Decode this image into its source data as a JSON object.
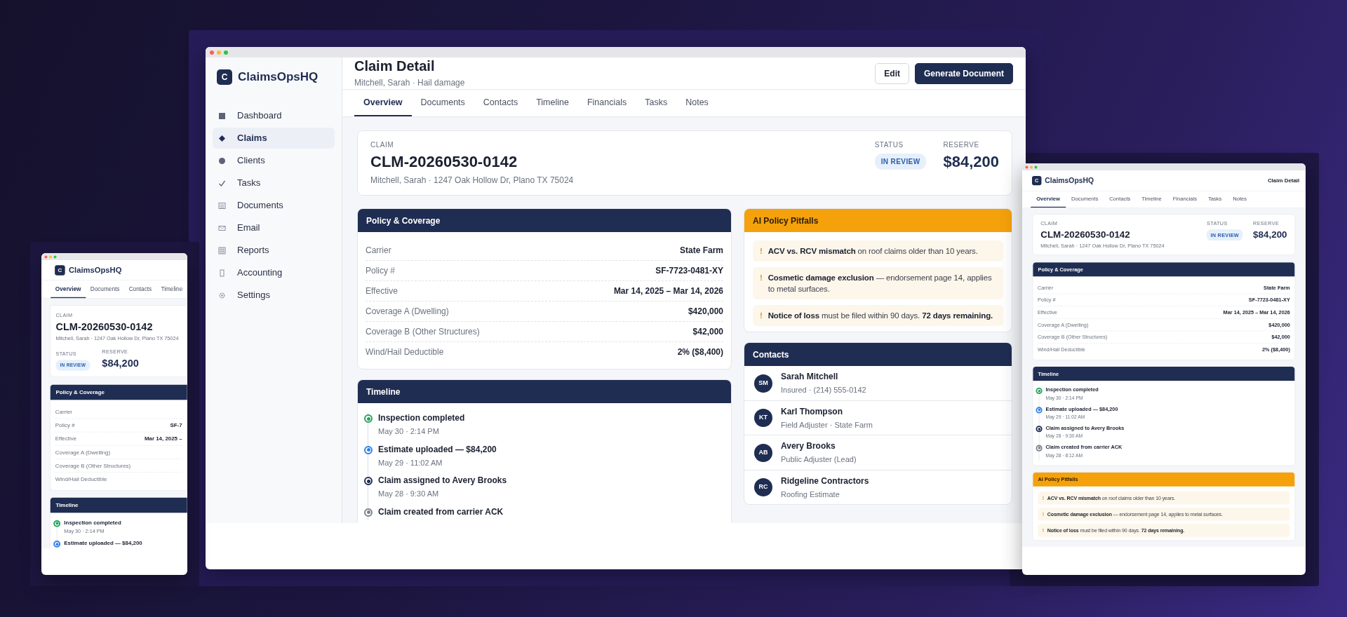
{
  "windows": [
    {
      "kind": "desktop",
      "brand": {
        "logo": "C",
        "name": "ClaimsOpsHQ"
      },
      "sidebar": {
        "items": [
          {
            "label": "Dashboard",
            "selected": false
          },
          {
            "label": "Claims",
            "selected": true
          },
          {
            "label": "Clients",
            "selected": false
          },
          {
            "label": "Tasks",
            "selected": false
          },
          {
            "label": "Documents",
            "selected": false
          },
          {
            "label": "Email",
            "selected": false
          },
          {
            "label": "Reports",
            "selected": false
          },
          {
            "label": "Accounting",
            "selected": false
          },
          {
            "label": "Settings",
            "selected": false
          }
        ]
      },
      "header": {
        "title": "Claim Detail",
        "subtitle": "Mitchell, Sarah · Hail damage",
        "buttons": [
          {
            "label": "Edit",
            "kind": "outline"
          },
          {
            "label": "Generate Document",
            "kind": "primary"
          }
        ]
      },
      "tabs": [
        {
          "label": "Overview",
          "selected": true
        },
        {
          "label": "Documents",
          "selected": false
        },
        {
          "label": "Contacts",
          "selected": false
        },
        {
          "label": "Timeline",
          "selected": false
        },
        {
          "label": "Financials",
          "selected": false
        },
        {
          "label": "Tasks",
          "selected": false
        },
        {
          "label": "Notes",
          "selected": false
        }
      ],
      "claim": {
        "label": "CLAIM",
        "number": "CLM-20260530-0142",
        "address": "Mitchell, Sarah · 1247 Oak Hollow Dr, Plano TX 75024",
        "status_label": "STATUS",
        "status": "IN REVIEW",
        "reserve_label": "RESERVE",
        "reserve": "$84,200"
      },
      "columns": [
        [
          {
            "kind": "policy",
            "title": "Policy & Coverage",
            "rows": [
              {
                "label": "Carrier",
                "value": "State Farm"
              },
              {
                "label": "Policy #",
                "value": "SF-7723-0481-XY"
              },
              {
                "label": "Effective",
                "value": "Mar 14, 2025 – Mar 14, 2026"
              },
              {
                "label": "Coverage A (Dwelling)",
                "value": "$420,000"
              },
              {
                "label": "Coverage B (Other Structures)",
                "value": "$42,000"
              },
              {
                "label": "Wind/Hail Deductible",
                "value": "2% ($8,400)"
              }
            ]
          },
          {
            "kind": "timeline",
            "title": "Timeline",
            "items": [
              {
                "title": "Inspection completed",
                "time": "May 30 · 2:14 PM",
                "color": "#22a55b"
              },
              {
                "title": "Estimate uploaded — $84,200",
                "time": "May 29 · 11:02 AM",
                "color": "#2f80ed"
              },
              {
                "title": "Claim assigned to Avery Brooks",
                "time": "May 28 · 9:30 AM",
                "color": "#1f2d52"
              },
              {
                "title": "Claim created from carrier ACK",
                "color": "#7b8190"
              }
            ]
          }
        ],
        [
          {
            "kind": "pitfalls",
            "title": "AI Policy Pitfalls",
            "items": [
              {
                "icon": "!",
                "text": "**ACV vs. RCV mismatch** on roof claims older than 10 years."
              },
              {
                "icon": "!",
                "text": "**Cosmetic damage exclusion** — endorsement page 14, applies to metal surfaces."
              },
              {
                "icon": "!",
                "text": "**Notice of loss** must be filed within 90 days. **72 days remaining.**"
              }
            ]
          },
          {
            "kind": "contacts",
            "title": "Contacts",
            "items": [
              {
                "initials": "SM",
                "name": "Sarah Mitchell",
                "detail": "Insured · (214) 555-0142"
              },
              {
                "initials": "KT",
                "name": "Karl Thompson",
                "detail": "Field Adjuster · State Farm"
              },
              {
                "initials": "AB",
                "name": "Avery Brooks",
                "detail": "Public Adjuster (Lead)"
              },
              {
                "initials": "RC",
                "name": "Ridgeline Contractors",
                "detail": "Roofing Estimate"
              }
            ]
          }
        ]
      ]
    },
    {
      "kind": "phone",
      "brand": {
        "logo": "C",
        "name": "ClaimsOpsHQ"
      },
      "tabs": [
        {
          "label": "Overview",
          "selected": true
        },
        {
          "label": "Documents",
          "selected": false
        },
        {
          "label": "Contacts",
          "selected": false
        },
        {
          "label": "Timeline",
          "selected": false
        }
      ],
      "claim": {
        "label": "CLAIM",
        "number": "CLM-20260530-0142",
        "address": "Mitchell, Sarah · 1247 Oak Hollow Dr, Plano TX 75024",
        "status_label": "STATUS",
        "status": "IN REVIEW",
        "reserve_label": "RESERVE",
        "reserve": "$84,200"
      },
      "sections": [
        {
          "kind": "policy",
          "title": "Policy & Coverage",
          "rows": [
            {
              "label": "Carrier"
            },
            {
              "label": "Policy #",
              "value": "SF-7"
            },
            {
              "label": "Effective",
              "value": "Mar 14, 2025 –"
            },
            {
              "label": "Coverage A (Dwelling)"
            },
            {
              "label": "Coverage B (Other Structures)"
            },
            {
              "label": "Wind/Hail Deductible"
            }
          ]
        },
        {
          "kind": "timeline",
          "title": "Timeline",
          "items": [
            {
              "title": "Inspection completed",
              "time": "May 30 · 2:14 PM",
              "color": "#22a55b"
            },
            {
              "title": "Estimate uploaded — $84,200",
              "color": "#2f80ed"
            }
          ]
        }
      ]
    },
    {
      "kind": "tablet",
      "brand": {
        "logo": "C",
        "name": "ClaimsOpsHQ"
      },
      "header": {
        "title": "Claim Detail"
      },
      "tabs": [
        {
          "label": "Overview",
          "selected": true
        },
        {
          "label": "Documents",
          "selected": false
        },
        {
          "label": "Contacts",
          "selected": false
        },
        {
          "label": "Timeline",
          "selected": false
        },
        {
          "label": "Financials",
          "selected": false
        },
        {
          "label": "Tasks",
          "selected": false
        },
        {
          "label": "Notes",
          "selected": false
        }
      ],
      "claim": {
        "label": "CLAIM",
        "number": "CLM-20260530-0142",
        "address": "Mitchell, Sarah · 1247 Oak Hollow Dr, Plano TX 75024",
        "status_label": "STATUS",
        "status": "IN REVIEW",
        "reserve_label": "RESERVE",
        "reserve": "$84,200"
      },
      "sections": [
        {
          "kind": "policy",
          "title": "Policy & Coverage",
          "rows": [
            {
              "label": "Carrier",
              "value": "State Farm"
            },
            {
              "label": "Policy #",
              "value": "SF-7723-0481-XY"
            },
            {
              "label": "Effective",
              "value": "Mar 14, 2025 – Mar 14, 2026"
            },
            {
              "label": "Coverage A (Dwelling)",
              "value": "$420,000"
            },
            {
              "label": "Coverage B (Other Structures)",
              "value": "$42,000"
            },
            {
              "label": "Wind/Hail Deductible",
              "value": "2% ($8,400)"
            }
          ]
        },
        {
          "kind": "timeline",
          "title": "Timeline",
          "items": [
            {
              "title": "Inspection completed",
              "time": "May 30 · 2:14 PM",
              "color": "#22a55b"
            },
            {
              "title": "Estimate uploaded — $84,200",
              "time": "May 29 · 11:02 AM",
              "color": "#2f80ed"
            },
            {
              "title": "Claim assigned to Avery Brooks",
              "time": "May 28 · 9:30 AM",
              "color": "#1f2d52"
            },
            {
              "title": "Claim created from carrier ACK",
              "time": "May 28 · 8:12 AM",
              "color": "#7b8190"
            }
          ]
        },
        {
          "kind": "pitfalls",
          "title": "AI Policy Pitfalls",
          "items": [
            {
              "icon": "!",
              "text": "**ACV vs. RCV mismatch** on roof claims older than 10 years."
            },
            {
              "icon": "!",
              "text": "**Cosmetic damage exclusion** — endorsement page 14, applies to metal surfaces."
            },
            {
              "icon": "!",
              "text": "**Notice of loss** must be filed within 90 days. **72 days remaining.**"
            }
          ]
        }
      ]
    }
  ]
}
